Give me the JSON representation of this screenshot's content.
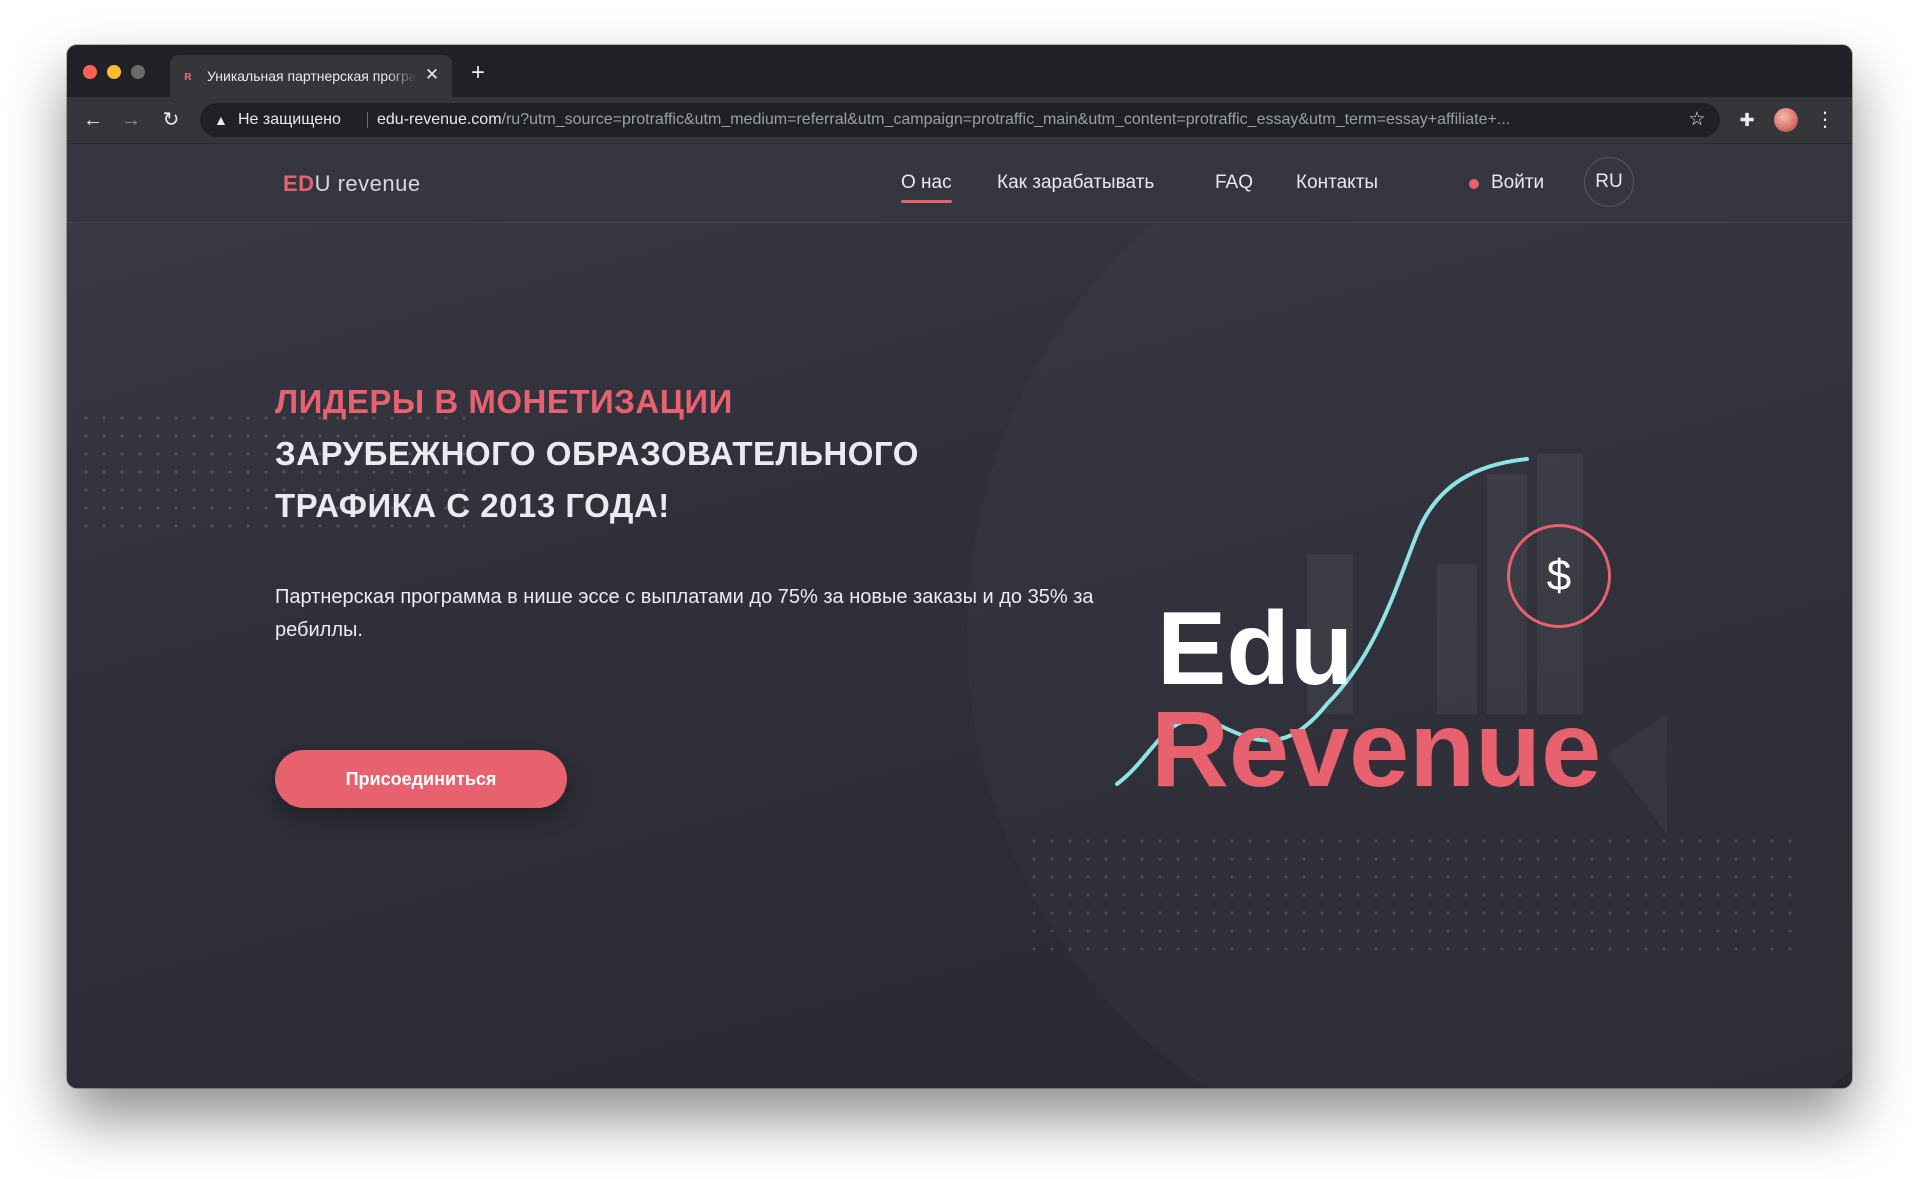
{
  "browser": {
    "tab": {
      "title": "Уникальная партнерская программа",
      "favicon": "edu-revenue-favicon",
      "close_icon": "✕"
    },
    "new_tab_icon": "+",
    "nav_icons": {
      "back": "←",
      "forward": "→",
      "reload": "↻"
    },
    "omnibox": {
      "warning_icon": "▲",
      "security_label": "Не защищено",
      "url_host": "edu-revenue.com",
      "url_path": "/ru?utm_source=protraffic&utm_medium=referral&utm_campaign=protraffic_main&utm_content=protraffic_essay&utm_term=essay+affiliate+...",
      "bookmark_icon": "☆"
    },
    "extensions_icon": "✚",
    "menu_icon": "⋮",
    "traffic_lights": [
      "#ff5f57",
      "#febc2e",
      "#6b6b6b"
    ]
  },
  "site": {
    "logo": {
      "mark": "ЕD",
      "rest": "U revenue"
    },
    "nav": [
      {
        "label": "О нас",
        "active": true
      },
      {
        "label": "Как зарабатывать",
        "active": false
      },
      {
        "label": "FAQ",
        "active": false
      },
      {
        "label": "Контакты",
        "active": false
      }
    ],
    "login_label": "Войти",
    "language": "RU",
    "hero": {
      "title_accent": "ЛИДЕРЫ В МОНЕТИЗАЦИИ",
      "title_line2": "ЗАРУБЕЖНОГО ОБРАЗОВАТЕЛЬНОГО",
      "title_line3": "ТРАФИКА С 2013 ГОДА!",
      "description": "Партнерская программа в нише эссе с выплатами до 75% за новые заказы и до 35% за ребиллы.",
      "cta_label": "Присоединиться",
      "art_word_1": "Edu",
      "art_word_2": "Revenue",
      "coin_symbol": "$"
    }
  },
  "colors": {
    "accent": "#e7616f",
    "teal_line": "#8ee3e6",
    "page_bg": "#2d2d36",
    "header_bg": "#363640"
  }
}
